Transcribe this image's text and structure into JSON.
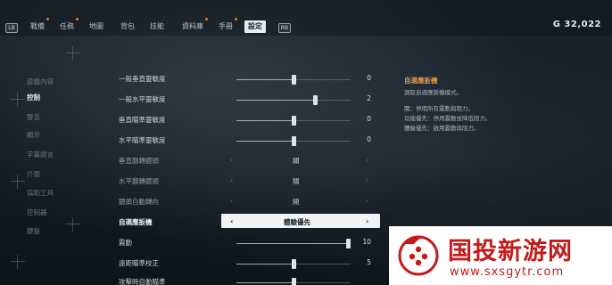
{
  "nav": {
    "left_badge": "LB",
    "right_badge": "RB",
    "tabs": [
      {
        "label": "戰備",
        "dot": true
      },
      {
        "label": "任務",
        "dot": true
      },
      {
        "label": "地圖",
        "dot": false
      },
      {
        "label": "背包",
        "dot": false
      },
      {
        "label": "技能",
        "dot": false
      },
      {
        "label": "資料庫",
        "dot": true
      },
      {
        "label": "手冊",
        "dot": true
      },
      {
        "label": "設定",
        "dot": false
      }
    ],
    "active_tab": "設定",
    "currency": "G  32,022"
  },
  "categories": [
    {
      "label": "遊戲內容",
      "active": false
    },
    {
      "label": "控制",
      "active": true
    },
    {
      "label": "聲音",
      "active": false
    },
    {
      "label": "顯示",
      "active": false
    },
    {
      "label": "字幕語言",
      "active": false
    },
    {
      "label": "介面",
      "active": false
    },
    {
      "label": "協助工具",
      "active": false
    },
    {
      "label": "控制器",
      "active": false
    },
    {
      "label": "鍵盤",
      "active": false
    }
  ],
  "settings": [
    {
      "label": "一般垂直靈敏度",
      "type": "slider",
      "value": "0",
      "level": 0.5
    },
    {
      "label": "一般水平靈敏度",
      "type": "slider",
      "value": "2",
      "level": 0.7
    },
    {
      "label": "垂直瞄準靈敏度",
      "type": "slider",
      "value": "0",
      "level": 0.5
    },
    {
      "label": "水平瞄準靈敏度",
      "type": "slider",
      "value": "0",
      "level": 0.5
    },
    {
      "label": "垂直翻轉鏡頭",
      "type": "choice",
      "value": "關"
    },
    {
      "label": "水平翻轉鏡頭",
      "type": "choice",
      "value": "關"
    },
    {
      "label": "鏡頭自動轉向",
      "type": "choice",
      "value": "開"
    },
    {
      "label": "自適應扳機",
      "type": "choice",
      "value": "體驗優先",
      "selected": true
    },
    {
      "label": "震動",
      "type": "slider",
      "value": "10",
      "level": 1.0
    },
    {
      "label": "遠距瞄準校正",
      "type": "slider",
      "value": "5",
      "level": 0.5
    },
    {
      "label": "攻擊時自動瞄準",
      "type": "slider",
      "value": "",
      "level": 0.5
    }
  ],
  "description": {
    "title": "自適應扳機",
    "subtitle": "調取自適應扳機模式。",
    "lines": [
      "關：停用所有震動與阻力。",
      "功能優先：停用震動並降低阻力。",
      "體驗優先：啟用震動與阻力。"
    ]
  },
  "watermark": {
    "title": "国投新游网",
    "url": "www.sxsgytr.com"
  },
  "colors": {
    "accent_orange": "#e39a45",
    "watermark_red": "#c41a1a",
    "selected_bg": "#f1f3f5"
  }
}
